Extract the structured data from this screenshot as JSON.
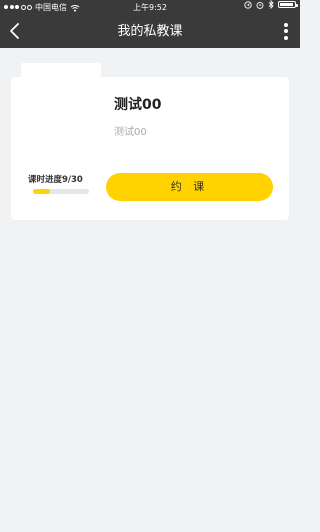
{
  "status_bar": {
    "carrier": "中国电信",
    "time": "上午9:52",
    "icons": [
      "signal-dots-icon",
      "wifi-icon",
      "location-icon",
      "alarm-icon",
      "bluetooth-icon",
      "battery-icon"
    ]
  },
  "header": {
    "title": "我的私教课",
    "back_icon": "chevron-left-icon",
    "more_icon": "more-vertical-icon"
  },
  "course": {
    "name": "测试00",
    "description": "测试00",
    "progress_label": "课时进度9/30",
    "progress_fraction": 0.3,
    "book_button": "约 课"
  },
  "colors": {
    "header_bg": "#3a3a3a",
    "accent": "#ffd200",
    "page_bg": "#f1f2f4"
  }
}
